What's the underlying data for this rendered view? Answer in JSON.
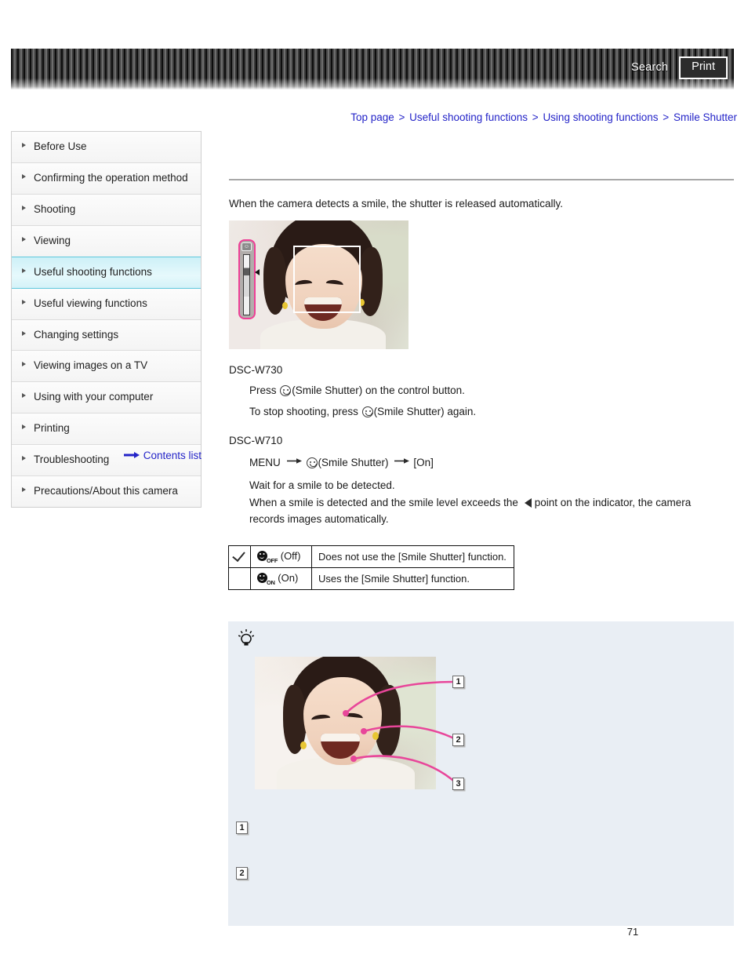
{
  "header": {
    "search_label": "Search",
    "print_label": "Print"
  },
  "breadcrumb": {
    "items": [
      {
        "label": "Top page"
      },
      {
        "label": "Useful shooting functions"
      },
      {
        "label": "Using shooting functions"
      },
      {
        "label": "Smile Shutter"
      }
    ],
    "separator": ">"
  },
  "sidebar": {
    "items": [
      {
        "label": "Before Use",
        "active": false
      },
      {
        "label": "Confirming the operation method",
        "active": false
      },
      {
        "label": "Shooting",
        "active": false
      },
      {
        "label": "Viewing",
        "active": false
      },
      {
        "label": "Useful shooting functions",
        "active": true
      },
      {
        "label": "Useful viewing functions",
        "active": false
      },
      {
        "label": "Changing settings",
        "active": false
      },
      {
        "label": "Viewing images on a TV",
        "active": false
      },
      {
        "label": "Using with your computer",
        "active": false
      },
      {
        "label": "Printing",
        "active": false
      },
      {
        "label": "Troubleshooting",
        "active": false
      },
      {
        "label": "Precautions/About this camera",
        "active": false
      }
    ],
    "contents_list_label": "Contents list",
    "active_color": "#cdf0f7",
    "link_color": "#2424c8"
  },
  "main": {
    "intro": "When the camera detects a smile, the shutter is released automatically.",
    "model_w730": {
      "heading": "DSC-W730",
      "line1_pre": "Press ",
      "line1_post": "(Smile Shutter) on the control button.",
      "line2_pre": "To stop shooting, press ",
      "line2_post": "(Smile Shutter) again."
    },
    "model_w710": {
      "heading": "DSC-W710",
      "menu_label": "MENU",
      "menu_mid": "(Smile Shutter)",
      "menu_value": "[On]",
      "para_line1": "Wait for a smile to be detected.",
      "para_line2_pre": "When a smile is detected and the smile level exceeds the ",
      "para_line2_post": "point on the indicator, the camera",
      "para_line3": "records images automatically."
    },
    "lcd_shot": {
      "alt": "camera-lcd-smile-shutter-screen",
      "frame_color": "#ffffff",
      "indicator_color": "#ee3f96"
    },
    "options_table": {
      "rows": [
        {
          "checked": true,
          "icon_sub": "OFF",
          "option_label": "(Off)",
          "description": "Does not use the [Smile Shutter] function."
        },
        {
          "checked": false,
          "icon_sub": "ON",
          "option_label": "(On)",
          "description": "Uses the [Smile Shutter] function."
        }
      ]
    },
    "tip": {
      "illustration_alt": "smile-detection-points-illustration",
      "callout_color": "#e8469a",
      "callouts": [
        "1",
        "2",
        "3"
      ],
      "notes": [
        {
          "num": "1",
          "text": ""
        },
        {
          "num": "2",
          "text": ""
        }
      ]
    },
    "page_number": "71"
  }
}
